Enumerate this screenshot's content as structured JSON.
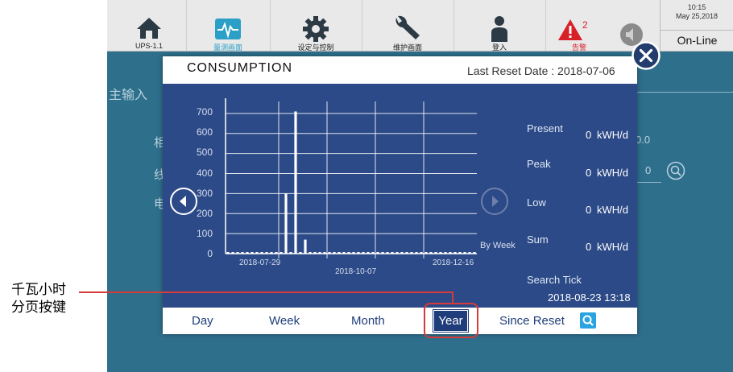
{
  "annotation": {
    "line1": "千瓦小时",
    "line2": "分页按键"
  },
  "topbar": {
    "items": [
      {
        "label": "UPS-1.1",
        "icon": "home-icon"
      },
      {
        "label": "量测画面",
        "icon": "waveform-icon"
      },
      {
        "label": "设定与控制",
        "icon": "gear-icon"
      },
      {
        "label": "维护画面",
        "icon": "wrench-icon"
      },
      {
        "label": "登入",
        "icon": "user-icon"
      },
      {
        "label": "告警",
        "icon": "alarm-icon",
        "badge": "2"
      },
      {
        "label": "",
        "icon": "mute-icon"
      }
    ],
    "time": "10:15",
    "date": "May 25,2018",
    "status": "On-Line"
  },
  "background": {
    "section_title": "主输入",
    "row1": "相",
    "row2": "线",
    "row3": "电",
    "value1": "0.0",
    "value2": "0"
  },
  "dialog": {
    "title": "CONSUMPTION",
    "last_reset": "Last Reset Date : 2018-07-06",
    "mode": "By Week",
    "stats": [
      {
        "label": "Present",
        "value": "0",
        "unit": "kWH/d"
      },
      {
        "label": "Peak",
        "value": "0",
        "unit": "kWH/d"
      },
      {
        "label": "Low",
        "value": "0",
        "unit": "kWH/d"
      },
      {
        "label": "Sum",
        "value": "0",
        "unit": "kWH/d"
      }
    ],
    "search_tick_label": "Search Tick",
    "search_tick_value": "2018-08-23 13:18",
    "tabs": [
      "Day",
      "Week",
      "Month",
      "Year",
      "Since Reset"
    ],
    "active_tab": "Year"
  },
  "colors": {
    "panel": "#2c4a87",
    "alarm": "#d72027",
    "highlight": "#d63a3a",
    "screen_bg": "#2e6f8c"
  },
  "chart_data": {
    "type": "bar",
    "x_tick_labels": [
      "2018-07-29",
      "2018-10-07",
      "2018-12-16"
    ],
    "y_ticks": [
      "0",
      "100",
      "200",
      "300",
      "400",
      "500",
      "600",
      "700"
    ],
    "ylim": [
      0,
      760
    ],
    "grid": true,
    "x": [
      0,
      1,
      2,
      3,
      4,
      5,
      6,
      7,
      8,
      9,
      10,
      11,
      12,
      13,
      14,
      15,
      16,
      17,
      18,
      19,
      20,
      21,
      22,
      23,
      24,
      25,
      26,
      27,
      28,
      29,
      30,
      31,
      32,
      33,
      34,
      35,
      36,
      37,
      38,
      39,
      40,
      41,
      42,
      43,
      44,
      45,
      46,
      47,
      48,
      49,
      50,
      51
    ],
    "values": [
      0,
      0,
      0,
      0,
      0,
      0,
      0,
      0,
      0,
      0,
      0,
      0,
      300,
      0,
      710,
      0,
      70,
      0,
      0,
      0,
      0,
      0,
      0,
      0,
      0,
      0,
      0,
      0,
      0,
      0,
      0,
      0,
      0,
      0,
      0,
      0,
      0,
      0,
      0,
      0,
      0,
      0,
      0,
      0,
      0,
      0,
      0,
      0,
      0,
      0,
      0,
      0
    ]
  }
}
